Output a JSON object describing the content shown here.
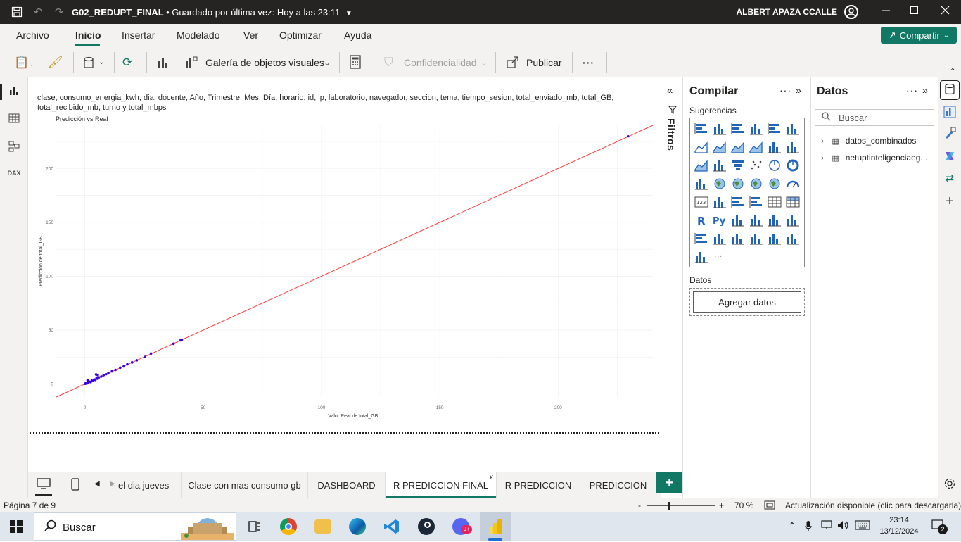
{
  "titlebar": {
    "file_name": "G02_REDUPT_FINAL",
    "saved_text": "• Guardado por última vez: Hoy a las 23:11",
    "user": "ALBERT APAZA CCALLE"
  },
  "menu": {
    "items": [
      "Archivo",
      "Inicio",
      "Insertar",
      "Modelado",
      "Ver",
      "Optimizar",
      "Ayuda"
    ],
    "active": "Inicio",
    "share_label": "Compartir"
  },
  "ribbon": {
    "gallery_label": "Galería de objetos visuales",
    "confidential_label": "Confidencialidad",
    "publish_label": "Publicar",
    "more_label": "···"
  },
  "visual": {
    "header": "clase, consumo_energia_kwh, dia, docente, Año, Trimestre, Mes, Día, horario, id, ip, laboratorio, navegador, seccion, tema, tiempo_sesion, total_enviado_mb, total_GB, total_recibido_mb, turno y total_mbps"
  },
  "chart_data": {
    "type": "scatter",
    "title": "Predicción vs Real",
    "xlabel": "Valor Real de total_GB",
    "ylabel": "Predicción de total_GB",
    "xlim": [
      -12,
      240
    ],
    "ylim": [
      -12,
      240
    ],
    "x_ticks": [
      0,
      50,
      100,
      150,
      200
    ],
    "y_ticks": [
      0,
      50,
      100,
      150,
      200
    ],
    "grid": true,
    "point_color": "#3a00e5",
    "reference_line": {
      "color": "#ff3b3b",
      "x": [
        -12,
        240
      ],
      "y": [
        -12,
        240
      ]
    },
    "points": [
      {
        "x": 0.2,
        "y": 0.3
      },
      {
        "x": 0.5,
        "y": 0.8
      },
      {
        "x": 0.8,
        "y": 0.5
      },
      {
        "x": 1.0,
        "y": 1.2
      },
      {
        "x": 1.2,
        "y": 3.5
      },
      {
        "x": 1.5,
        "y": 1.5
      },
      {
        "x": 2.0,
        "y": 2.2
      },
      {
        "x": 2.5,
        "y": 1.8
      },
      {
        "x": 3.0,
        "y": 3.2
      },
      {
        "x": 3.5,
        "y": 2.8
      },
      {
        "x": 4.0,
        "y": 4.2
      },
      {
        "x": 4.5,
        "y": 3.8
      },
      {
        "x": 5.0,
        "y": 5.3
      },
      {
        "x": 5.5,
        "y": 5.0
      },
      {
        "x": 6.0,
        "y": 6.2
      },
      {
        "x": 4.8,
        "y": 8.9
      },
      {
        "x": 5.5,
        "y": 8.3
      },
      {
        "x": 7.0,
        "y": 7.0
      },
      {
        "x": 8.0,
        "y": 8.2
      },
      {
        "x": 9.0,
        "y": 9.1
      },
      {
        "x": 10.0,
        "y": 10.0
      },
      {
        "x": 11.5,
        "y": 11.8
      },
      {
        "x": 13.0,
        "y": 13.1
      },
      {
        "x": 15.0,
        "y": 15.2
      },
      {
        "x": 16.5,
        "y": 16.4
      },
      {
        "x": 18.0,
        "y": 18.3
      },
      {
        "x": 20.0,
        "y": 20.1
      },
      {
        "x": 22.0,
        "y": 22.0
      },
      {
        "x": 25.5,
        "y": 25.2
      },
      {
        "x": 28.0,
        "y": 28.3
      },
      {
        "x": 37.5,
        "y": 37.4
      },
      {
        "x": 40.5,
        "y": 40.6
      },
      {
        "x": 41.0,
        "y": 41.0
      },
      {
        "x": 229.5,
        "y": 229.8
      }
    ]
  },
  "filters": {
    "label": "Filtros"
  },
  "build": {
    "title": "Compilar",
    "suggestions_label": "Sugerencias",
    "data_label": "Datos",
    "add_data_label": "Agregar datos"
  },
  "data": {
    "title": "Datos",
    "search_placeholder": "Buscar",
    "tables": [
      "datos_combinados",
      "netuptinteligenciaeg..."
    ]
  },
  "page_tabs": {
    "tabs": [
      "el dia jueves",
      "Clase con mas consumo gb",
      "DASHBOARD",
      "R PREDICCION FINAL",
      "R PREDICCION",
      "PREDICCION"
    ],
    "active": "R PREDICCION FINAL",
    "close_glyph": "x",
    "add_glyph": "+"
  },
  "status": {
    "page": "Página 7 de 9",
    "zoom_minus": "-",
    "zoom_plus": "+",
    "zoom_percent": "70 %",
    "zoom_level": 0.33,
    "update_text": "Actualización disponible (clic para descargarla)"
  },
  "taskbar": {
    "search_label": "Buscar",
    "time": "23:14",
    "date": "13/12/2024",
    "notification_count": "2",
    "app_badge": "9+"
  },
  "colors": {
    "accent": "#117865",
    "titlebar": "#252423",
    "point": "#3a00e5",
    "line": "#ff3b3b"
  }
}
